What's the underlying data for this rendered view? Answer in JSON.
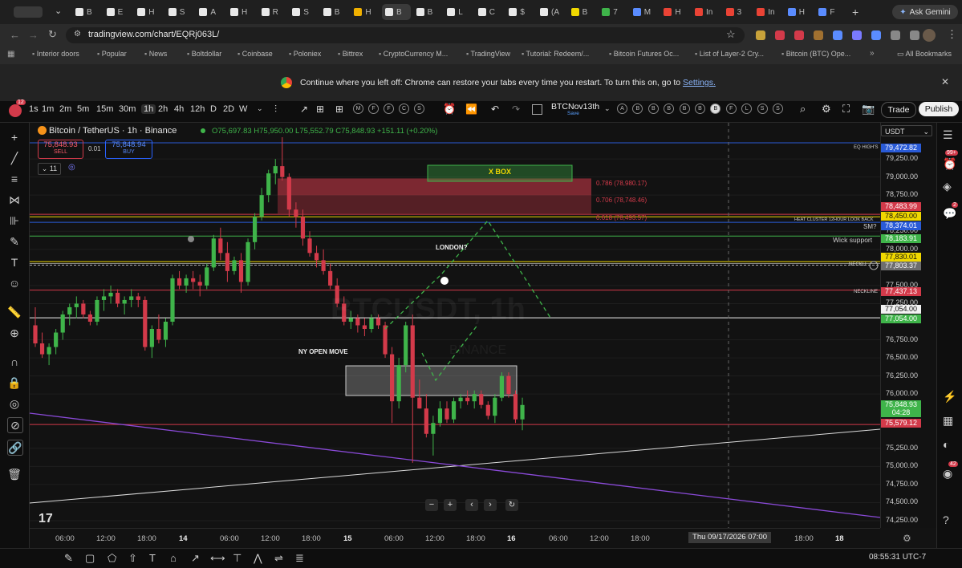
{
  "browser": {
    "tabs": [
      "B",
      "E",
      "H",
      "S",
      "A",
      "H",
      "R",
      "S",
      "B",
      "H",
      "B",
      "B",
      "L",
      "C",
      "$",
      "(A",
      "B",
      "7",
      "M",
      "H",
      "In",
      "3",
      "In",
      "H",
      "F"
    ],
    "ask_gemini": "Ask Gemini",
    "url": "tradingview.com/chart/EQRj063L/",
    "bookmarks": [
      "Interior doors",
      "Popular",
      "News",
      "Boltdollar",
      "Coinbase",
      "Poloniex",
      "Bittrex",
      "CryptoCurrency M...",
      "TradingView",
      "Tutorial: Redeem/...",
      "Bitcoin Futures Oc...",
      "List of Layer-2 Cry...",
      "Bitcoin (BTC) Ope..."
    ],
    "all_bookmarks": "All Bookmarks",
    "restore_message": "Continue where you left off: Chrome can restore your tabs every time you restart. To turn this on, go to ",
    "restore_link": "Settings."
  },
  "toolbar": {
    "notification_count": "12",
    "timeframes": [
      "1s",
      "1m",
      "2m",
      "5m",
      "15m",
      "30m",
      "1h",
      "2h",
      "4h",
      "12h",
      "D",
      "2D",
      "W"
    ],
    "selected_timeframe": "1h",
    "layout_circles": [
      "M",
      "F",
      "F",
      "C",
      "S"
    ],
    "layout_name": "BTCNov13th",
    "layout_status": "Save",
    "indicator_circles": [
      "A",
      "B",
      "B",
      "B",
      "B",
      "B",
      "B",
      "F",
      "L",
      "S",
      "S"
    ],
    "trade": "Trade",
    "publish": "Publish"
  },
  "legend": {
    "title": "Bitcoin / TetherUS · 1h · Binance",
    "ohlc": "O75,697.83 H75,950.00 L75,552.79 C75,848.93 +151.11 (+0.20%)",
    "sell_price": "75,848.93",
    "sell_label": "SELL",
    "spread": "0.01",
    "buy_price": "75,848.94",
    "buy_label": "BUY",
    "indicators_count": "11",
    "watermark": "BTCUSDT, 1h",
    "watermark_sub": "BINANCE"
  },
  "currency": "USDT",
  "annotations": {
    "xbox": "X BOX",
    "fib_786": "0.786 (78,980.17)",
    "fib_706": "0.706 (78,748.46)",
    "fib_618": "0.618 (78,493.57)",
    "london": "LONDON?",
    "ny_open": "NY OPEN MOVE",
    "eq_highs": "EQ HIGH'S",
    "heat_cluster": "HEAT CLUSTER 12HOUR LOOK BACK",
    "smq": "SM?",
    "wick_support": "Wick support",
    "neckline1": "NECKLI",
    "neckline2": "NECKLINE"
  },
  "price_axis": [
    "79,250.00",
    "79,000.00",
    "78,750.00",
    "78,250.00",
    "78,000.00",
    "77,500.00",
    "77,250.00",
    "76,750.00",
    "76,500.00",
    "76,250.00",
    "76,000.00",
    "75,250.00",
    "75,000.00",
    "74,750.00",
    "74,500.00",
    "74,250.00"
  ],
  "price_badges": [
    {
      "text": "79,472.82",
      "bg": "#2a5bd7",
      "fg": "#ffffff"
    },
    {
      "text": "78,483.99",
      "bg": "#d33a4a",
      "fg": "#ffffff"
    },
    {
      "text": "78,450.00",
      "bg": "#f0d800",
      "fg": "#111111"
    },
    {
      "text": "78,374.01",
      "bg": "#2a5bd7",
      "fg": "#ffffff"
    },
    {
      "text": "78,183.91",
      "bg": "#3fb44a",
      "fg": "#ffffff"
    },
    {
      "text": "77,830.01",
      "bg": "#f0d800",
      "fg": "#111111"
    },
    {
      "text": "77,803.37",
      "bg": "#6e6e6e",
      "fg": "#ffffff"
    },
    {
      "text": "77,437.13",
      "bg": "#d33a4a",
      "fg": "#ffffff"
    },
    {
      "text": "77,054.00",
      "bg": "#f2f2f2",
      "fg": "#111111"
    },
    {
      "text": "77,054.00",
      "bg": "#3fb44a",
      "fg": "#ffffff"
    },
    {
      "text": "75,848.93",
      "bg": "#3fb44a",
      "fg": "#ffffff"
    },
    {
      "text": "04:28",
      "bg": "#3fb44a",
      "fg": "#ffffff"
    },
    {
      "text": "75,579.12",
      "bg": "#d33a4a",
      "fg": "#ffffff"
    }
  ],
  "time_axis": [
    "06:00",
    "12:00",
    "18:00",
    "14",
    "06:00",
    "12:00",
    "18:00",
    "15",
    "06:00",
    "12:00",
    "18:00",
    "16",
    "06:00",
    "12:00",
    "18:00",
    "17",
    "18:00",
    "18"
  ],
  "crosshair_time": "Thu 09/17/2026   07:00",
  "clock": "08:55:31 UTC-7",
  "right_badges": {
    "b1": "99+",
    "b2": "2",
    "b3": "42"
  },
  "colors": {
    "up": "#3fb44a",
    "down": "#d33a4a",
    "accent": "#2962ff"
  },
  "chart_data": {
    "type": "candlestick",
    "symbol": "Bitcoin / TetherUS",
    "interval": "1h",
    "ylim": [
      74150,
      79750
    ],
    "candles": [
      [
        76950,
        77200,
        76650,
        76700
      ],
      [
        76700,
        76850,
        76500,
        76550
      ],
      [
        76550,
        76700,
        76400,
        76650
      ],
      [
        76650,
        76900,
        76550,
        76850
      ],
      [
        76850,
        77150,
        76750,
        77100
      ],
      [
        77100,
        77250,
        76950,
        77200
      ],
      [
        77200,
        77350,
        77050,
        77250
      ],
      [
        77250,
        77300,
        77050,
        77100
      ],
      [
        77100,
        77150,
        76950,
        77000
      ],
      [
        77000,
        77350,
        76950,
        77300
      ],
      [
        77300,
        77450,
        77150,
        77350
      ],
      [
        77350,
        77500,
        77250,
        77400
      ],
      [
        77400,
        77450,
        77200,
        77250
      ],
      [
        77250,
        77350,
        77100,
        77300
      ],
      [
        77300,
        77450,
        77200,
        77350
      ],
      [
        77350,
        77400,
        77200,
        77300
      ],
      [
        77300,
        77350,
        76600,
        76650
      ],
      [
        76650,
        76950,
        76500,
        76900
      ],
      [
        76900,
        77100,
        76700,
        76750
      ],
      [
        76750,
        77050,
        76650,
        77000
      ],
      [
        77000,
        77650,
        76950,
        77600
      ],
      [
        77600,
        77700,
        77450,
        77500
      ],
      [
        77500,
        77650,
        77400,
        77600
      ],
      [
        77600,
        77700,
        77450,
        77550
      ],
      [
        77550,
        77650,
        77350,
        77500
      ],
      [
        77500,
        77800,
        77450,
        77750
      ],
      [
        77750,
        78200,
        77700,
        78150
      ],
      [
        78150,
        78300,
        77850,
        77950
      ],
      [
        77950,
        78100,
        77550,
        77700
      ],
      [
        77700,
        77900,
        77650,
        77850
      ],
      [
        77850,
        77950,
        77400,
        77550
      ],
      [
        77550,
        78150,
        77500,
        78100
      ],
      [
        78100,
        78500,
        78000,
        78450
      ],
      [
        78450,
        78850,
        78400,
        78750
      ],
      [
        78750,
        79100,
        78650,
        79050
      ],
      [
        79050,
        79250,
        78900,
        79150
      ],
      [
        79150,
        79550,
        78950,
        79000
      ],
      [
        79000,
        79050,
        78450,
        78550
      ],
      [
        78550,
        78650,
        78300,
        78450
      ],
      [
        78450,
        78550,
        78050,
        78150
      ],
      [
        78150,
        78250,
        77900,
        77950
      ],
      [
        77950,
        78050,
        77750,
        77850
      ],
      [
        77850,
        78000,
        77650,
        77700
      ],
      [
        77700,
        77800,
        77450,
        77500
      ],
      [
        77500,
        77600,
        77200,
        77250
      ],
      [
        77250,
        77350,
        76950,
        77000
      ],
      [
        77000,
        77150,
        76900,
        77050
      ],
      [
        77050,
        77100,
        76850,
        76950
      ],
      [
        76950,
        77050,
        76800,
        76900
      ],
      [
        76900,
        77100,
        76850,
        77050
      ],
      [
        77050,
        77100,
        76900,
        76950
      ],
      [
        76950,
        77000,
        76500,
        76550
      ],
      [
        76550,
        76650,
        75600,
        75900
      ],
      [
        75900,
        76500,
        75800,
        76400
      ],
      [
        76400,
        77000,
        76300,
        76950
      ],
      [
        76950,
        77100,
        75050,
        75950
      ],
      [
        75950,
        76200,
        75800,
        75800
      ],
      [
        75800,
        76000,
        75400,
        75450
      ],
      [
        75450,
        75700,
        75150,
        75600
      ],
      [
        75600,
        75900,
        75550,
        75800
      ],
      [
        75800,
        75900,
        75600,
        75650
      ],
      [
        75650,
        75950,
        75600,
        75900
      ],
      [
        75900,
        76000,
        75800,
        75950
      ],
      [
        75950,
        76050,
        75850,
        75900
      ],
      [
        75900,
        76050,
        75800,
        76000
      ],
      [
        76000,
        76050,
        75800,
        75850
      ],
      [
        75850,
        75900,
        75650,
        75700
      ],
      [
        75700,
        76000,
        75600,
        75950
      ],
      [
        75950,
        76300,
        75900,
        76250
      ],
      [
        76250,
        76300,
        75950,
        76000
      ],
      [
        76000,
        76050,
        75600,
        75650
      ],
      [
        75650,
        75950,
        75500,
        75848.93
      ]
    ]
  }
}
